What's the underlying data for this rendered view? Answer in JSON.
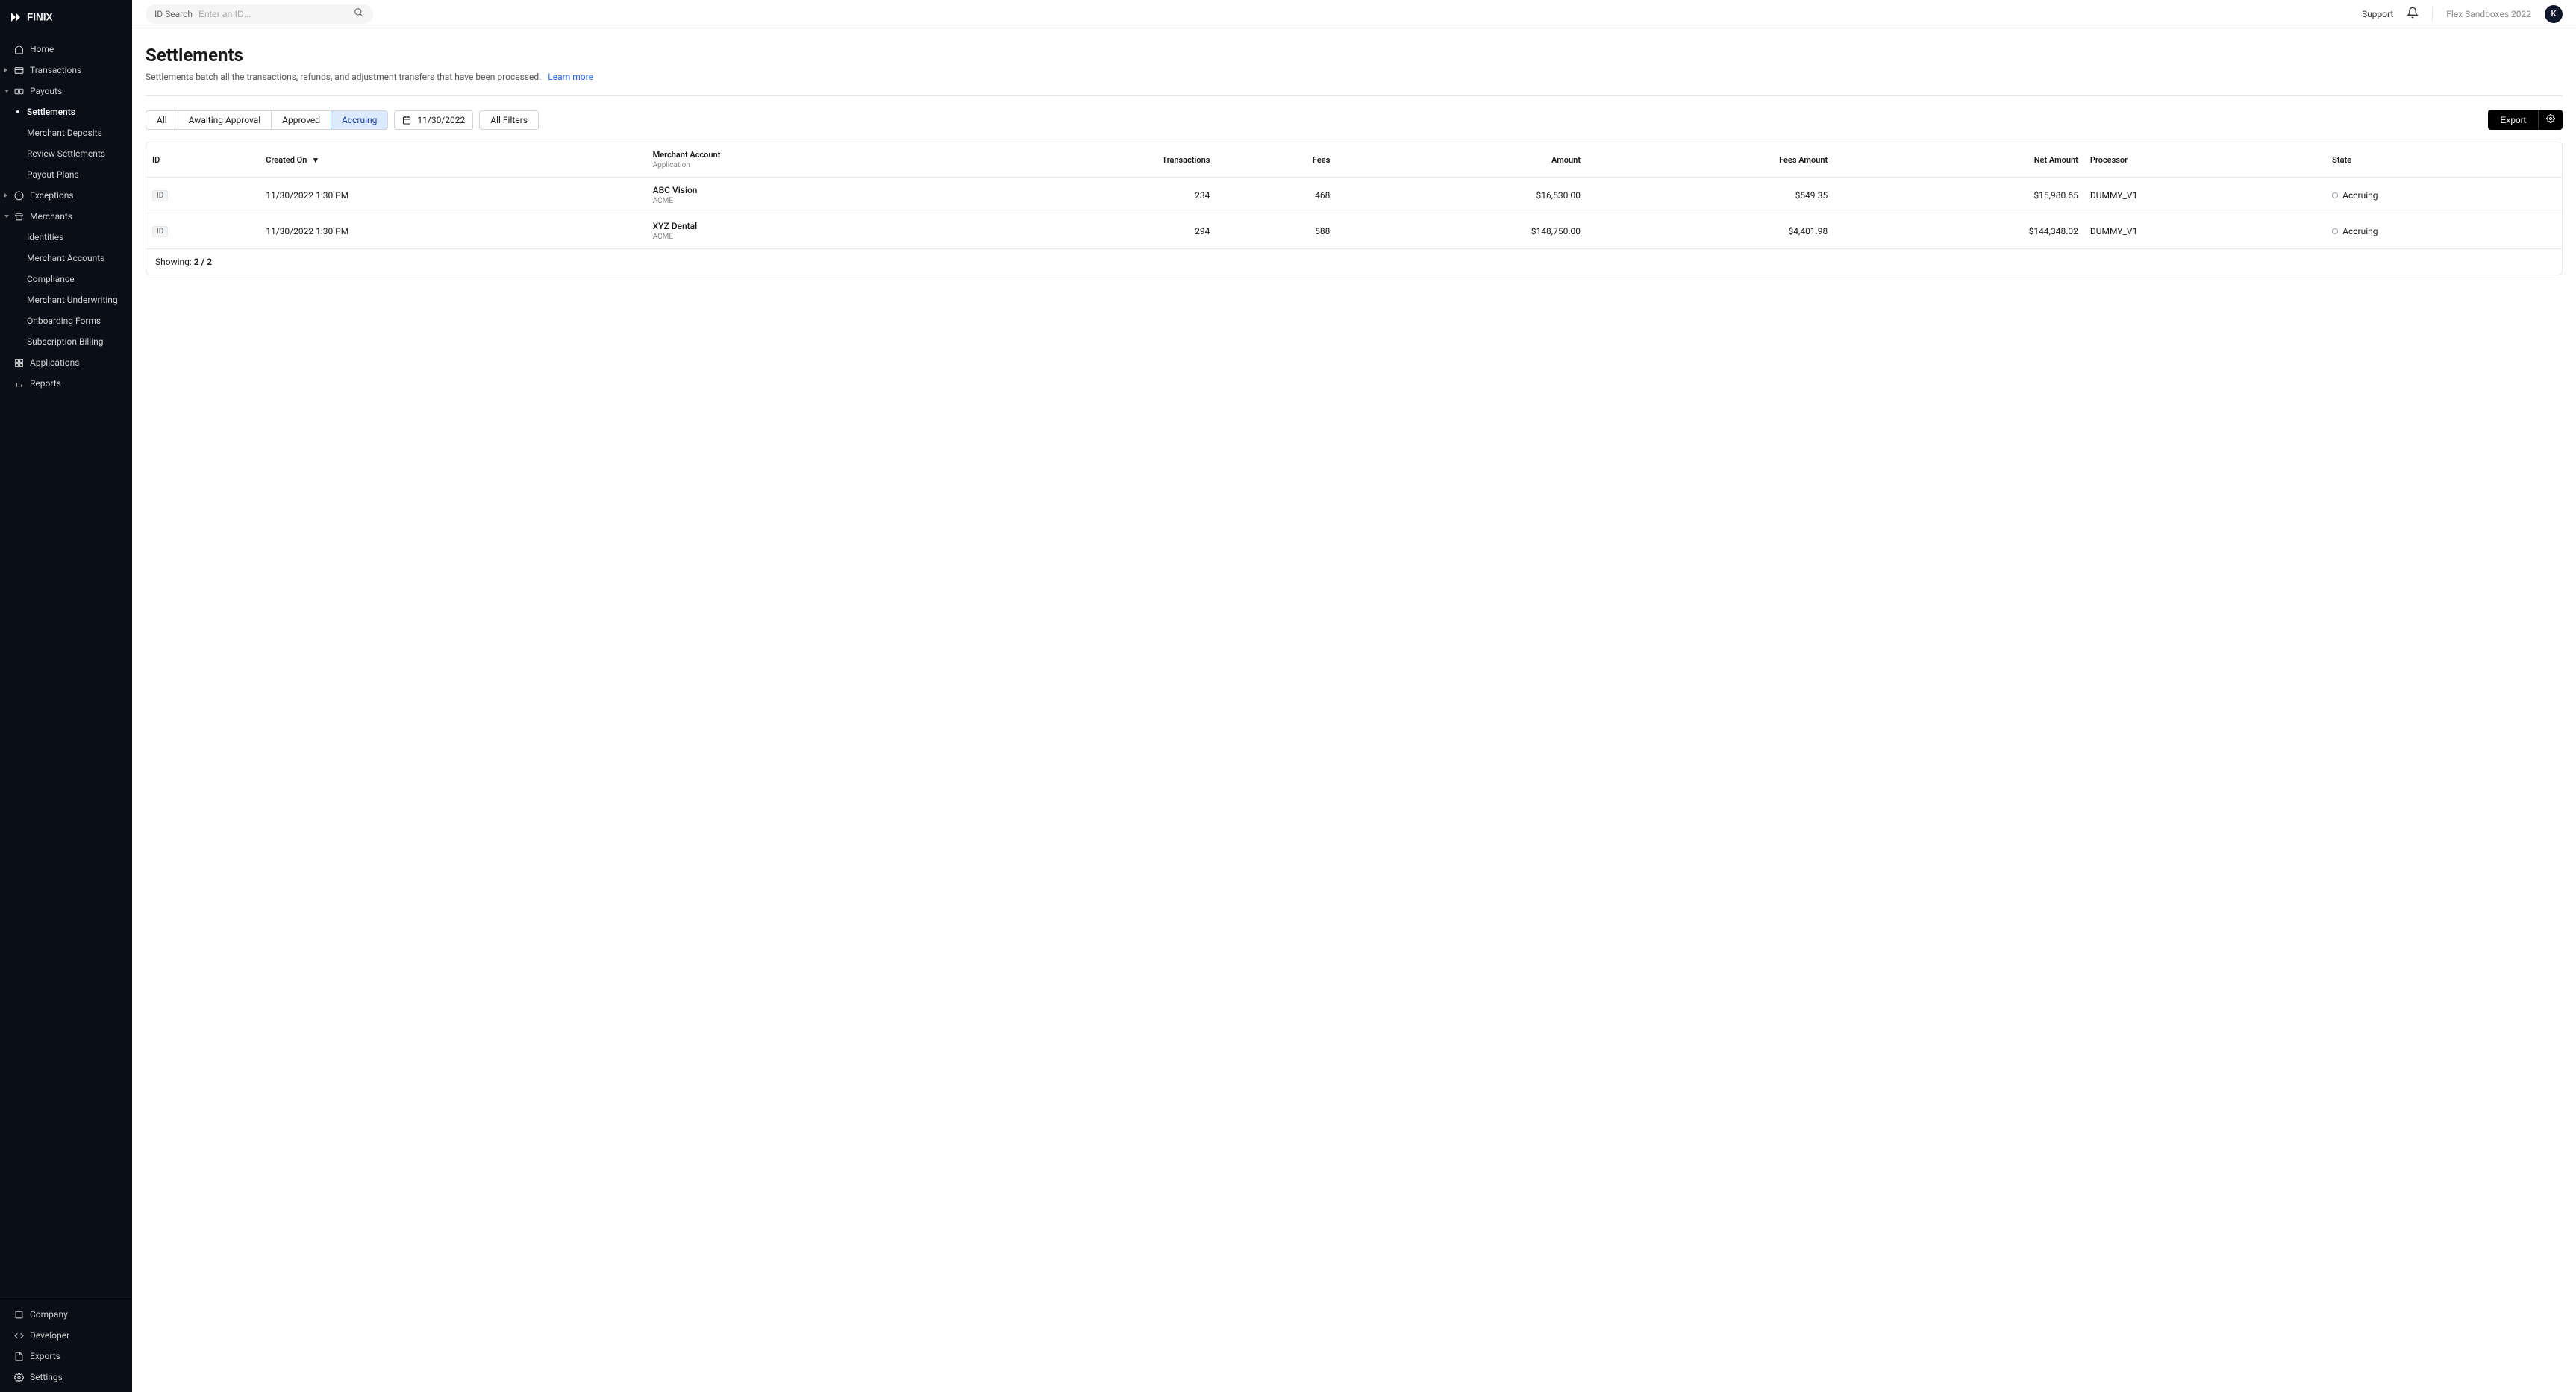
{
  "brand": "FINIX",
  "topbar": {
    "search_label": "ID Search",
    "search_placeholder": "Enter an ID...",
    "support": "Support",
    "org": "Flex Sandboxes 2022",
    "avatar_initial": "K"
  },
  "sidebar": {
    "top": [
      {
        "label": "Home",
        "icon": "home"
      },
      {
        "label": "Transactions",
        "icon": "card",
        "expandable": true
      },
      {
        "label": "Payouts",
        "icon": "payout",
        "expandable": true,
        "expanded": true,
        "children": [
          {
            "label": "Settlements",
            "active": true
          },
          {
            "label": "Merchant Deposits"
          },
          {
            "label": "Review Settlements"
          },
          {
            "label": "Payout Plans"
          }
        ]
      },
      {
        "label": "Exceptions",
        "icon": "exception",
        "expandable": true
      },
      {
        "label": "Merchants",
        "icon": "merchant",
        "expandable": true,
        "expanded": true,
        "children": [
          {
            "label": "Identities"
          },
          {
            "label": "Merchant Accounts"
          },
          {
            "label": "Compliance"
          },
          {
            "label": "Merchant Underwriting"
          },
          {
            "label": "Onboarding Forms"
          },
          {
            "label": "Subscription Billing"
          }
        ]
      },
      {
        "label": "Applications",
        "icon": "apps"
      },
      {
        "label": "Reports",
        "icon": "reports"
      }
    ],
    "bottom": [
      {
        "label": "Company",
        "icon": "company"
      },
      {
        "label": "Developer",
        "icon": "dev"
      },
      {
        "label": "Exports",
        "icon": "exports"
      },
      {
        "label": "Settings",
        "icon": "settings"
      }
    ]
  },
  "page": {
    "title": "Settlements",
    "description": "Settlements batch all the transactions, refunds, and adjustment transfers that have been processed.",
    "learn_more": "Learn more"
  },
  "filters": {
    "tabs": [
      "All",
      "Awaiting Approval",
      "Approved",
      "Accruing"
    ],
    "active_tab": "Accruing",
    "date": "11/30/2022",
    "all_filters": "All Filters",
    "export": "Export"
  },
  "table": {
    "columns": {
      "id": "ID",
      "created_on": "Created On",
      "merchant_account": "Merchant Account",
      "merchant_account_sub": "Application",
      "transactions": "Transactions",
      "fees": "Fees",
      "amount": "Amount",
      "fees_amount": "Fees Amount",
      "net_amount": "Net Amount",
      "processor": "Processor",
      "state": "State"
    },
    "rows": [
      {
        "id_badge": "ID",
        "created_on": "11/30/2022 1:30 PM",
        "merchant": "ABC Vision",
        "application": "ACME",
        "transactions": "234",
        "fees": "468",
        "amount": "$16,530.00",
        "fees_amount": "$549.35",
        "net_amount": "$15,980.65",
        "processor": "DUMMY_V1",
        "state": "Accruing"
      },
      {
        "id_badge": "ID",
        "created_on": "11/30/2022 1:30 PM",
        "merchant": "XYZ Dental",
        "application": "ACME",
        "transactions": "294",
        "fees": "588",
        "amount": "$148,750.00",
        "fees_amount": "$4,401.98",
        "net_amount": "$144,348.02",
        "processor": "DUMMY_V1",
        "state": "Accruing"
      }
    ],
    "showing_label": "Showing:",
    "showing_count": "2 / 2"
  }
}
